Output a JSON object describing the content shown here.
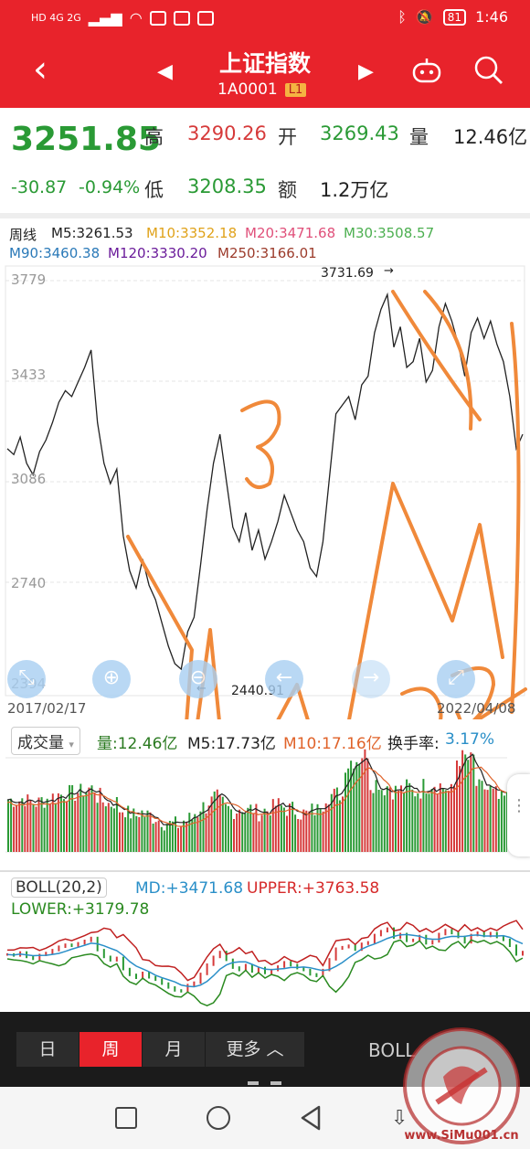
{
  "status_bar": {
    "left_text": "HD 4G 2G",
    "battery": "81",
    "time": "1:46"
  },
  "header": {
    "title": "上证指数",
    "code": "1A0001",
    "level": "L1"
  },
  "quote": {
    "price": "3251.85",
    "change": "-30.87",
    "change_pct": "-0.94%",
    "high_label": "高",
    "high": "3290.26",
    "open_label": "开",
    "open": "3269.43",
    "volume_label": "量",
    "volume": "12.46亿",
    "low_label": "低",
    "low": "3208.35",
    "amount_label": "额",
    "amount": "1.2万亿"
  },
  "chart": {
    "period_label": "周线",
    "ma": [
      {
        "text": "M5:3261.53",
        "color": "#222222"
      },
      {
        "text": "M10:3352.18",
        "color": "#e0a21a"
      },
      {
        "text": "M20:3471.68",
        "color": "#e0507a"
      },
      {
        "text": "M30:3508.57",
        "color": "#4caf50"
      },
      {
        "text": "M90:3460.38",
        "color": "#2a79b8"
      },
      {
        "text": "M120:3330.20",
        "color": "#6a1b9a"
      },
      {
        "text": "M250:3166.01",
        "color": "#9c3b2b"
      }
    ],
    "y_ticks": [
      "3779",
      "3433",
      "3086",
      "2740",
      "2394"
    ],
    "max_label": "3731.69",
    "min_label": "2440.91",
    "start_date": "2017/02/17",
    "end_date": "2022/04/08"
  },
  "chart_data": {
    "type": "line",
    "title": "上证指数 周线",
    "ylim": [
      2394,
      3779
    ],
    "x": [
      "2017/02/17",
      "2022/04/08"
    ],
    "series": [
      {
        "name": "",
        "values": [
          3200,
          3180,
          3240,
          3150,
          3110,
          3190,
          3230,
          3290,
          3360,
          3400,
          3380,
          3430,
          3480,
          3540,
          3290,
          3150,
          3080,
          3130,
          2900,
          2780,
          2720,
          2820,
          2730,
          2680,
          2600,
          2520,
          2460,
          2441,
          2570,
          2620,
          2800,
          2990,
          3150,
          3250,
          3090,
          2930,
          2880,
          2980,
          2850,
          2920,
          2820,
          2880,
          2950,
          3040,
          2980,
          2920,
          2880,
          2790,
          2760,
          2880,
          3100,
          3320,
          3350,
          3380,
          3300,
          3420,
          3450,
          3600,
          3680,
          3731,
          3550,
          3620,
          3480,
          3500,
          3580,
          3430,
          3470,
          3620,
          3700,
          3640,
          3560,
          3450,
          3600,
          3650,
          3580,
          3640,
          3560,
          3500,
          3380,
          3200,
          3250
        ]
      }
    ]
  },
  "volume_panel": {
    "dropdown_label": "成交量",
    "vol": "量:12.46亿",
    "m5": "M5:17.73亿",
    "m10": "M10:17.16亿",
    "turnover_label": "换手率:",
    "turnover": "3.17%"
  },
  "boll_panel": {
    "dropdown_label": "BOLL(20,2)",
    "md": "MD:+3471.68",
    "upper": "UPPER:+3763.58",
    "lower": "LOWER:+3179.78"
  },
  "tabs": [
    {
      "label": "日",
      "active": false
    },
    {
      "label": "周",
      "active": true
    },
    {
      "label": "月",
      "active": false
    },
    {
      "label": "更多 ︿",
      "active": false
    }
  ],
  "boll_tab": "BOLL",
  "watermark": "www.SiMu001.cn",
  "colors": {
    "brand_red": "#e8232b",
    "up": "#d63a3a",
    "down": "#2a9a35",
    "annotation": "#f0893a"
  }
}
